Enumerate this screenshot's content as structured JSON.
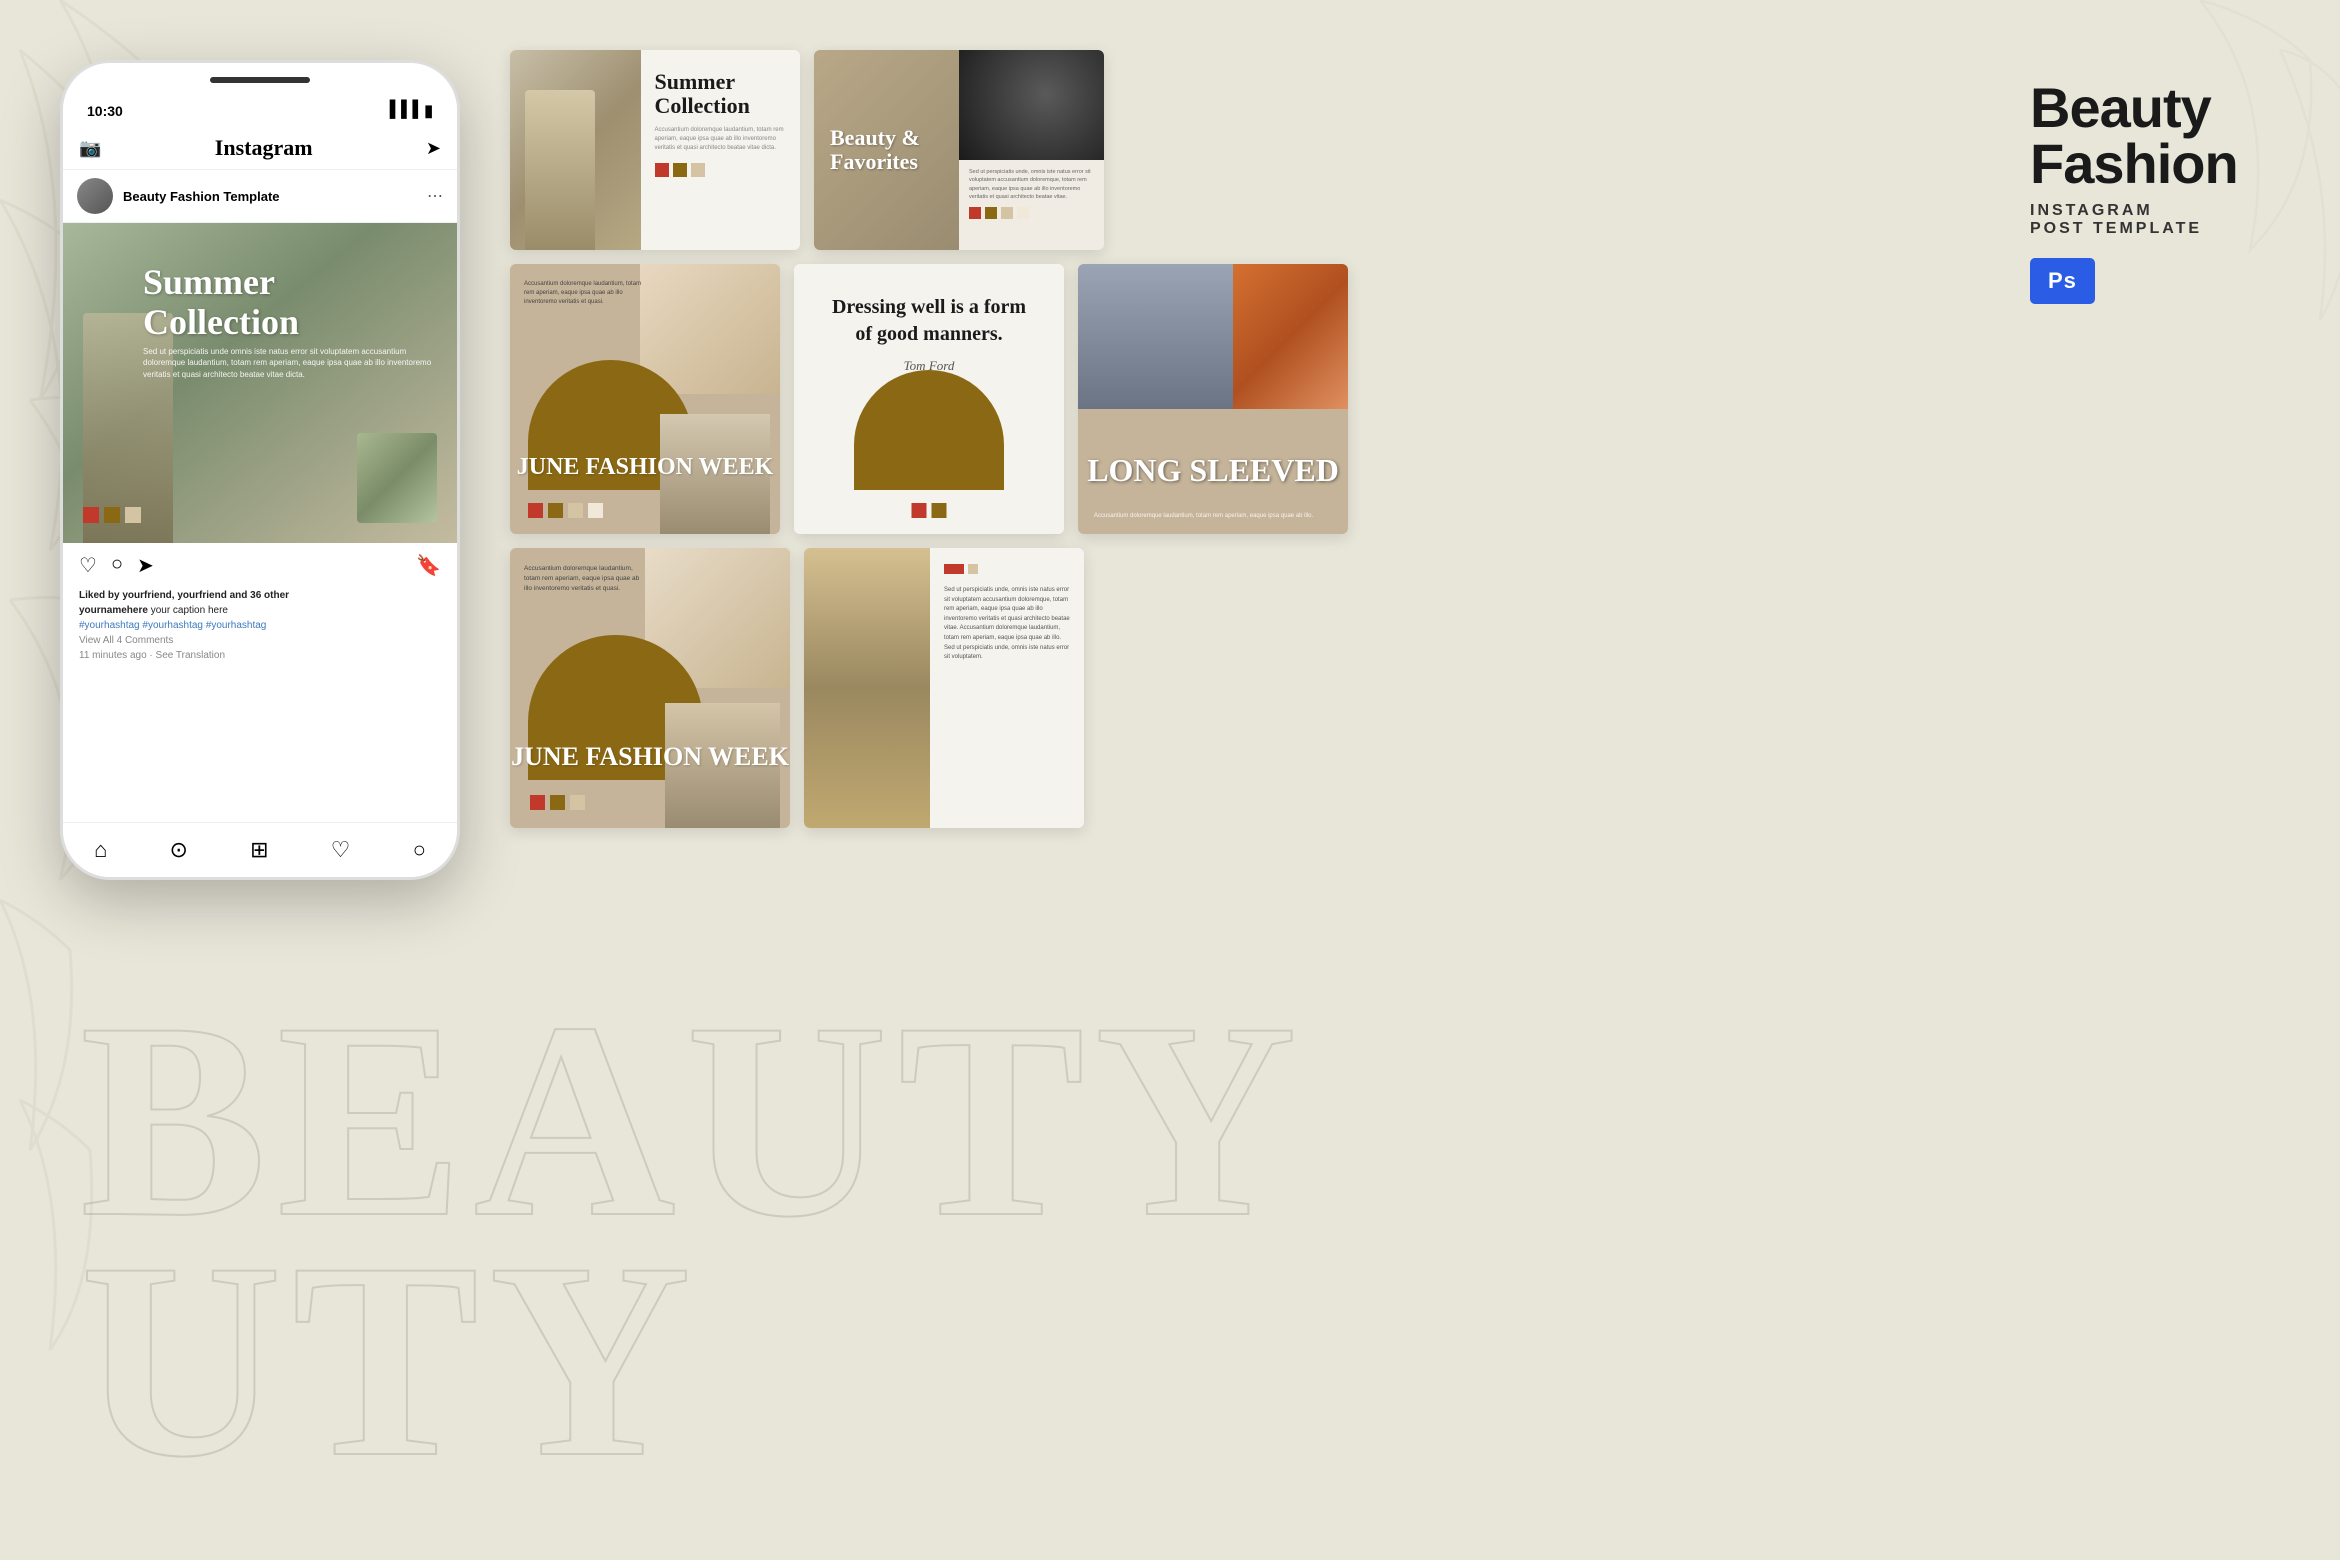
{
  "background": {
    "color": "#e8e6d9"
  },
  "title": {
    "line1": "Beauty",
    "line2": "Fashion",
    "sub": "INSTAGRAM",
    "sub2": "POST TEMPLATE",
    "ps_label": "Ps"
  },
  "watermark": "BEAUTY",
  "phone": {
    "time": "10:30",
    "app_name": "Instagram",
    "profile_name": "Beauty Fashion Template",
    "post_title": "Summer Collection",
    "post_description": "Sed ut perspiciatis unde omnis iste natus error sit voluptatem accusantium doloremque laudantium, totam rem aperiam, eaque ipsa quae ab illo inventoremo veritatis et quasi architecto beatae vitae dicta.",
    "liked_by": "Liked by yourfriend, yourfriend and 36 other",
    "your_name": "yournamehere",
    "caption": "your caption here",
    "hashtags": "#yourhashtag #yourhashtag #yourhashtag",
    "view_comments": "View All 4 Comments",
    "time_ago": "11 minutes ago · See Translation"
  },
  "cards": {
    "summer": {
      "title": "Summer Collection",
      "desc": "Accusantium doloremque laudantium, totam rem aperiam, eaque ipsa quae ab illo inventoremo veritatis et quasi architecto beatae vitae dicta."
    },
    "beauty_favorites": {
      "title": "Beauty & Favorites",
      "desc": "Sed ut perspiciatis unde, omnis iste natus error sit voluptatem accusantium doloremque, totam rem aperiam, eaque ipsa quae ab illo inventoremo veritatis et quasi architecto beatae vitae."
    },
    "june1": {
      "title": "JUNE FASHION WEEK",
      "desc": "Accusantium doloremque laudantium, totam rem aperiam, eaque ipsa quae ab illo inventoremo veritatis et quasi."
    },
    "quote": {
      "main": "Dressing well is a form of good manners.",
      "author": "Tom Ford"
    },
    "long_sleeved": {
      "title": "LONG SLEEVED",
      "desc": "Accusantium doloremque laudantium, totam rem aperiam, eaque ipsa quae ab illo."
    },
    "june2": {
      "title": "JUNE FASHION WEEK",
      "desc": "Accusantium doloremque laudantium, totam rem aperiam, eaque ipsa quae ab illo inventoremo veritatis et quasi."
    },
    "girl": {
      "desc": "Sed ut perspiciatis unde, omnis iste natus error sit voluptatem accusantium doloremque, totam rem aperiam, eaque ipsa quae ab illo inventoremo veritatis et quasi architecto beatae vitae. Accusantium doloremque laudantium, totam rem aperiam, eaque ipsa quae ab illo. Sed ut perspiciatis unde, omnis iste natus error sit voluptatem."
    }
  },
  "colors": {
    "background": "#e8e6d9",
    "brown_accent": "#8B6914",
    "red_accent": "#c0392b",
    "beige": "#d4c4a4",
    "dark": "#5a4a3a",
    "light_beige": "#f0e8d8"
  }
}
